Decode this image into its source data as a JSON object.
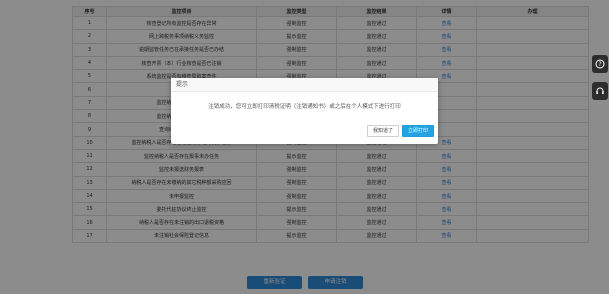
{
  "table": {
    "headers": [
      "序号",
      "监控项目",
      "监控类型",
      "监控结果",
      "详情",
      "办理"
    ],
    "rows": [
      {
        "no": "1",
        "item": "核查登记所有监控是否存在异常",
        "type": "强制监控",
        "result": "监控通过",
        "detail": "查看",
        "action": ""
      },
      {
        "no": "2",
        "item": "网上跨税务事项纳税义务监控",
        "type": "提示监控",
        "result": "监控通过",
        "detail": "查看",
        "action": ""
      },
      {
        "no": "3",
        "item": "逾期监管任务已在承接任务是否已办结",
        "type": "强制监控",
        "result": "监控通过",
        "detail": "查看",
        "action": ""
      },
      {
        "no": "4",
        "item": "核查开票（本）行业核查是否已注销",
        "type": "强制监控",
        "result": "监控通过",
        "detail": "查看",
        "action": ""
      },
      {
        "no": "5",
        "item": "系统监控是否有稽查局取案查件",
        "type": "强制监控",
        "result": "监控通过",
        "detail": "查看",
        "action": ""
      },
      {
        "no": "6",
        "item": "是否离职",
        "type": "",
        "result": "",
        "detail": "",
        "action": ""
      },
      {
        "no": "7",
        "item": "监控纳税人是否存在欠",
        "type": "",
        "result": "",
        "detail": "",
        "action": ""
      },
      {
        "no": "8",
        "item": "监控纳税人是否存在未",
        "type": "",
        "result": "",
        "detail": "",
        "action": ""
      },
      {
        "no": "9",
        "item": "查询纳税人是否存在",
        "type": "",
        "result": "",
        "detail": "",
        "action": ""
      },
      {
        "no": "10",
        "item": "监控纳税人是否存在已过征收办理的税办任务",
        "type": "强制监控",
        "result": "监控通过",
        "detail": "查看",
        "action": ""
      },
      {
        "no": "11",
        "item": "监控纳税人是否存在报事未办任务",
        "type": "提示监控",
        "result": "监控通过",
        "detail": "查看",
        "action": ""
      },
      {
        "no": "12",
        "item": "监控未报送财务报表",
        "type": "强制监控",
        "result": "监控通过",
        "detail": "查看",
        "action": ""
      },
      {
        "no": "13",
        "item": "纳税人是否存在未缴纳的其它税种额采购应回",
        "type": "强制监控",
        "result": "监控通过",
        "detail": "查看",
        "action": ""
      },
      {
        "no": "14",
        "item": "未申报监控",
        "type": "强制监控",
        "result": "监控通过",
        "detail": "查看",
        "action": ""
      },
      {
        "no": "15",
        "item": "委托代征协议终止监控",
        "type": "提示监控",
        "result": "监控通过",
        "detail": "查看",
        "action": ""
      },
      {
        "no": "16",
        "item": "纳税人是否存在未注销的出口退税资格",
        "type": "强制监控",
        "result": "监控通过",
        "detail": "查看",
        "action": ""
      },
      {
        "no": "17",
        "item": "未注销社会保险登记信息",
        "type": "提示监控",
        "result": "监控通过",
        "detail": "查看",
        "action": ""
      }
    ]
  },
  "buttons": {
    "recheck": "重新验证",
    "apply": "申请注销"
  },
  "dialog": {
    "title": "提示",
    "message": "注销成功，您可立即打印清税证明（注销通知书）或之后在个人模式下进行打印",
    "cancel_label": "我知道了",
    "print_label": "立即打印"
  },
  "side_icons": [
    "help-icon",
    "headset-icon"
  ],
  "colors": {
    "primary": "#2e8ad8",
    "link": "#2f7fd1",
    "overlay": "rgba(0,0,0,0.45)"
  }
}
